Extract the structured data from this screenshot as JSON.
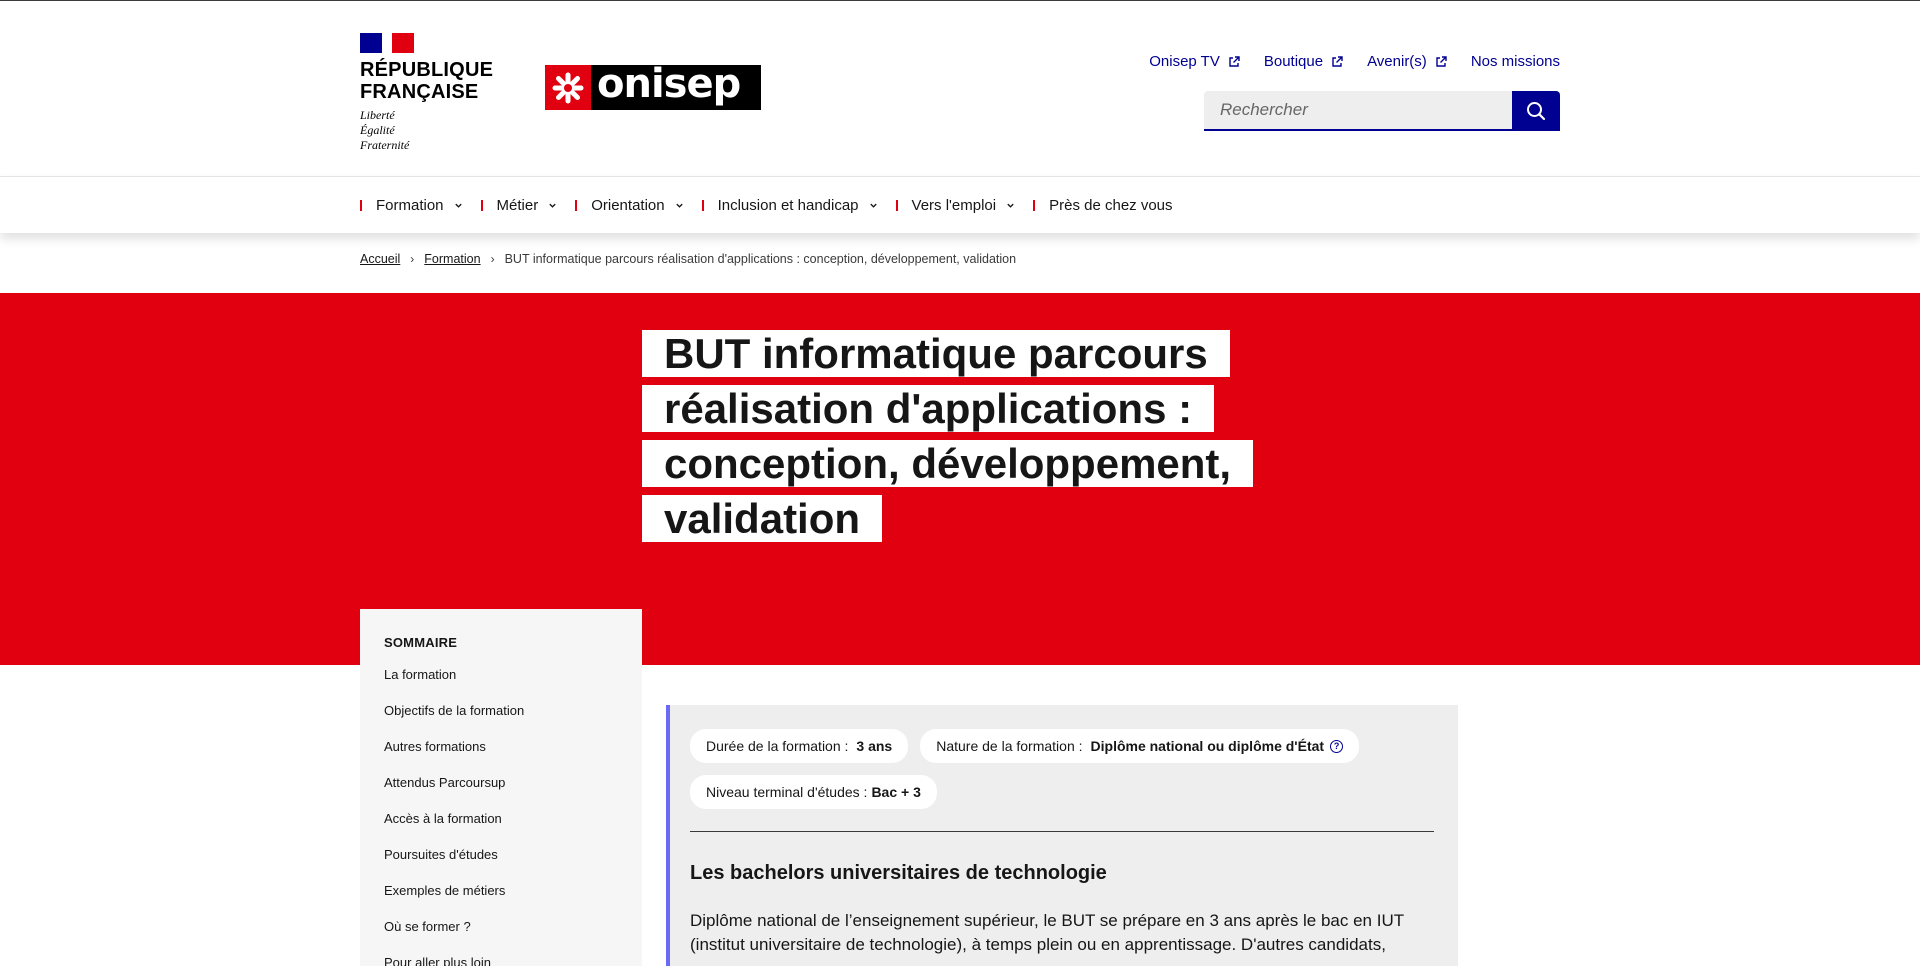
{
  "header": {
    "rf_name_line1": "RÉPUBLIQUE",
    "rf_name_line2": "FRANÇAISE",
    "rf_motto_1": "Liberté",
    "rf_motto_2": "Égalité",
    "rf_motto_3": "Fraternité",
    "logo_text": "onisep",
    "quicklinks": [
      {
        "label": "Onisep TV"
      },
      {
        "label": "Boutique"
      },
      {
        "label": "Avenir(s)"
      },
      {
        "label": "Nos missions"
      }
    ],
    "search_placeholder": "Rechercher"
  },
  "nav": {
    "items": [
      {
        "label": "Formation"
      },
      {
        "label": "Métier"
      },
      {
        "label": "Orientation"
      },
      {
        "label": "Inclusion et handicap"
      },
      {
        "label": "Vers l'emploi"
      },
      {
        "label": "Près de chez vous"
      }
    ]
  },
  "breadcrumb": {
    "home": "Accueil",
    "section": "Formation",
    "current": "BUT informatique parcours réalisation d'applications : conception, développement, validation"
  },
  "hero": {
    "title": "BUT informatique parcours réalisation d'applications : conception, développement, validation"
  },
  "sommaire": {
    "title": "SOMMAIRE",
    "items": [
      "La formation",
      "Objectifs de la formation",
      "Autres formations",
      "Attendus Parcoursup",
      "Accès à la formation",
      "Poursuites d'études",
      "Exemples de métiers",
      "Où se former ?",
      "Pour aller plus loin"
    ]
  },
  "card": {
    "duree_label": "Durée de la formation :",
    "duree_value": "3 ans",
    "nature_label": "Nature de la formation :",
    "nature_value": "Diplôme national ou diplôme d'État",
    "niveau_label": "Niveau terminal d'études :",
    "niveau_value": "Bac + 3",
    "heading": "Les bachelors universitaires de technologie",
    "paragraph": "Diplôme national de l’enseignement supérieur, le BUT se prépare en 3 ans après le bac en IUT (institut universitaire de technologie), à temps plein ou en apprentissage. D'autres candidats,"
  },
  "colors": {
    "brand_red": "#e1000f",
    "primary_blue": "#000091",
    "accent_purple": "#6a6af4"
  }
}
